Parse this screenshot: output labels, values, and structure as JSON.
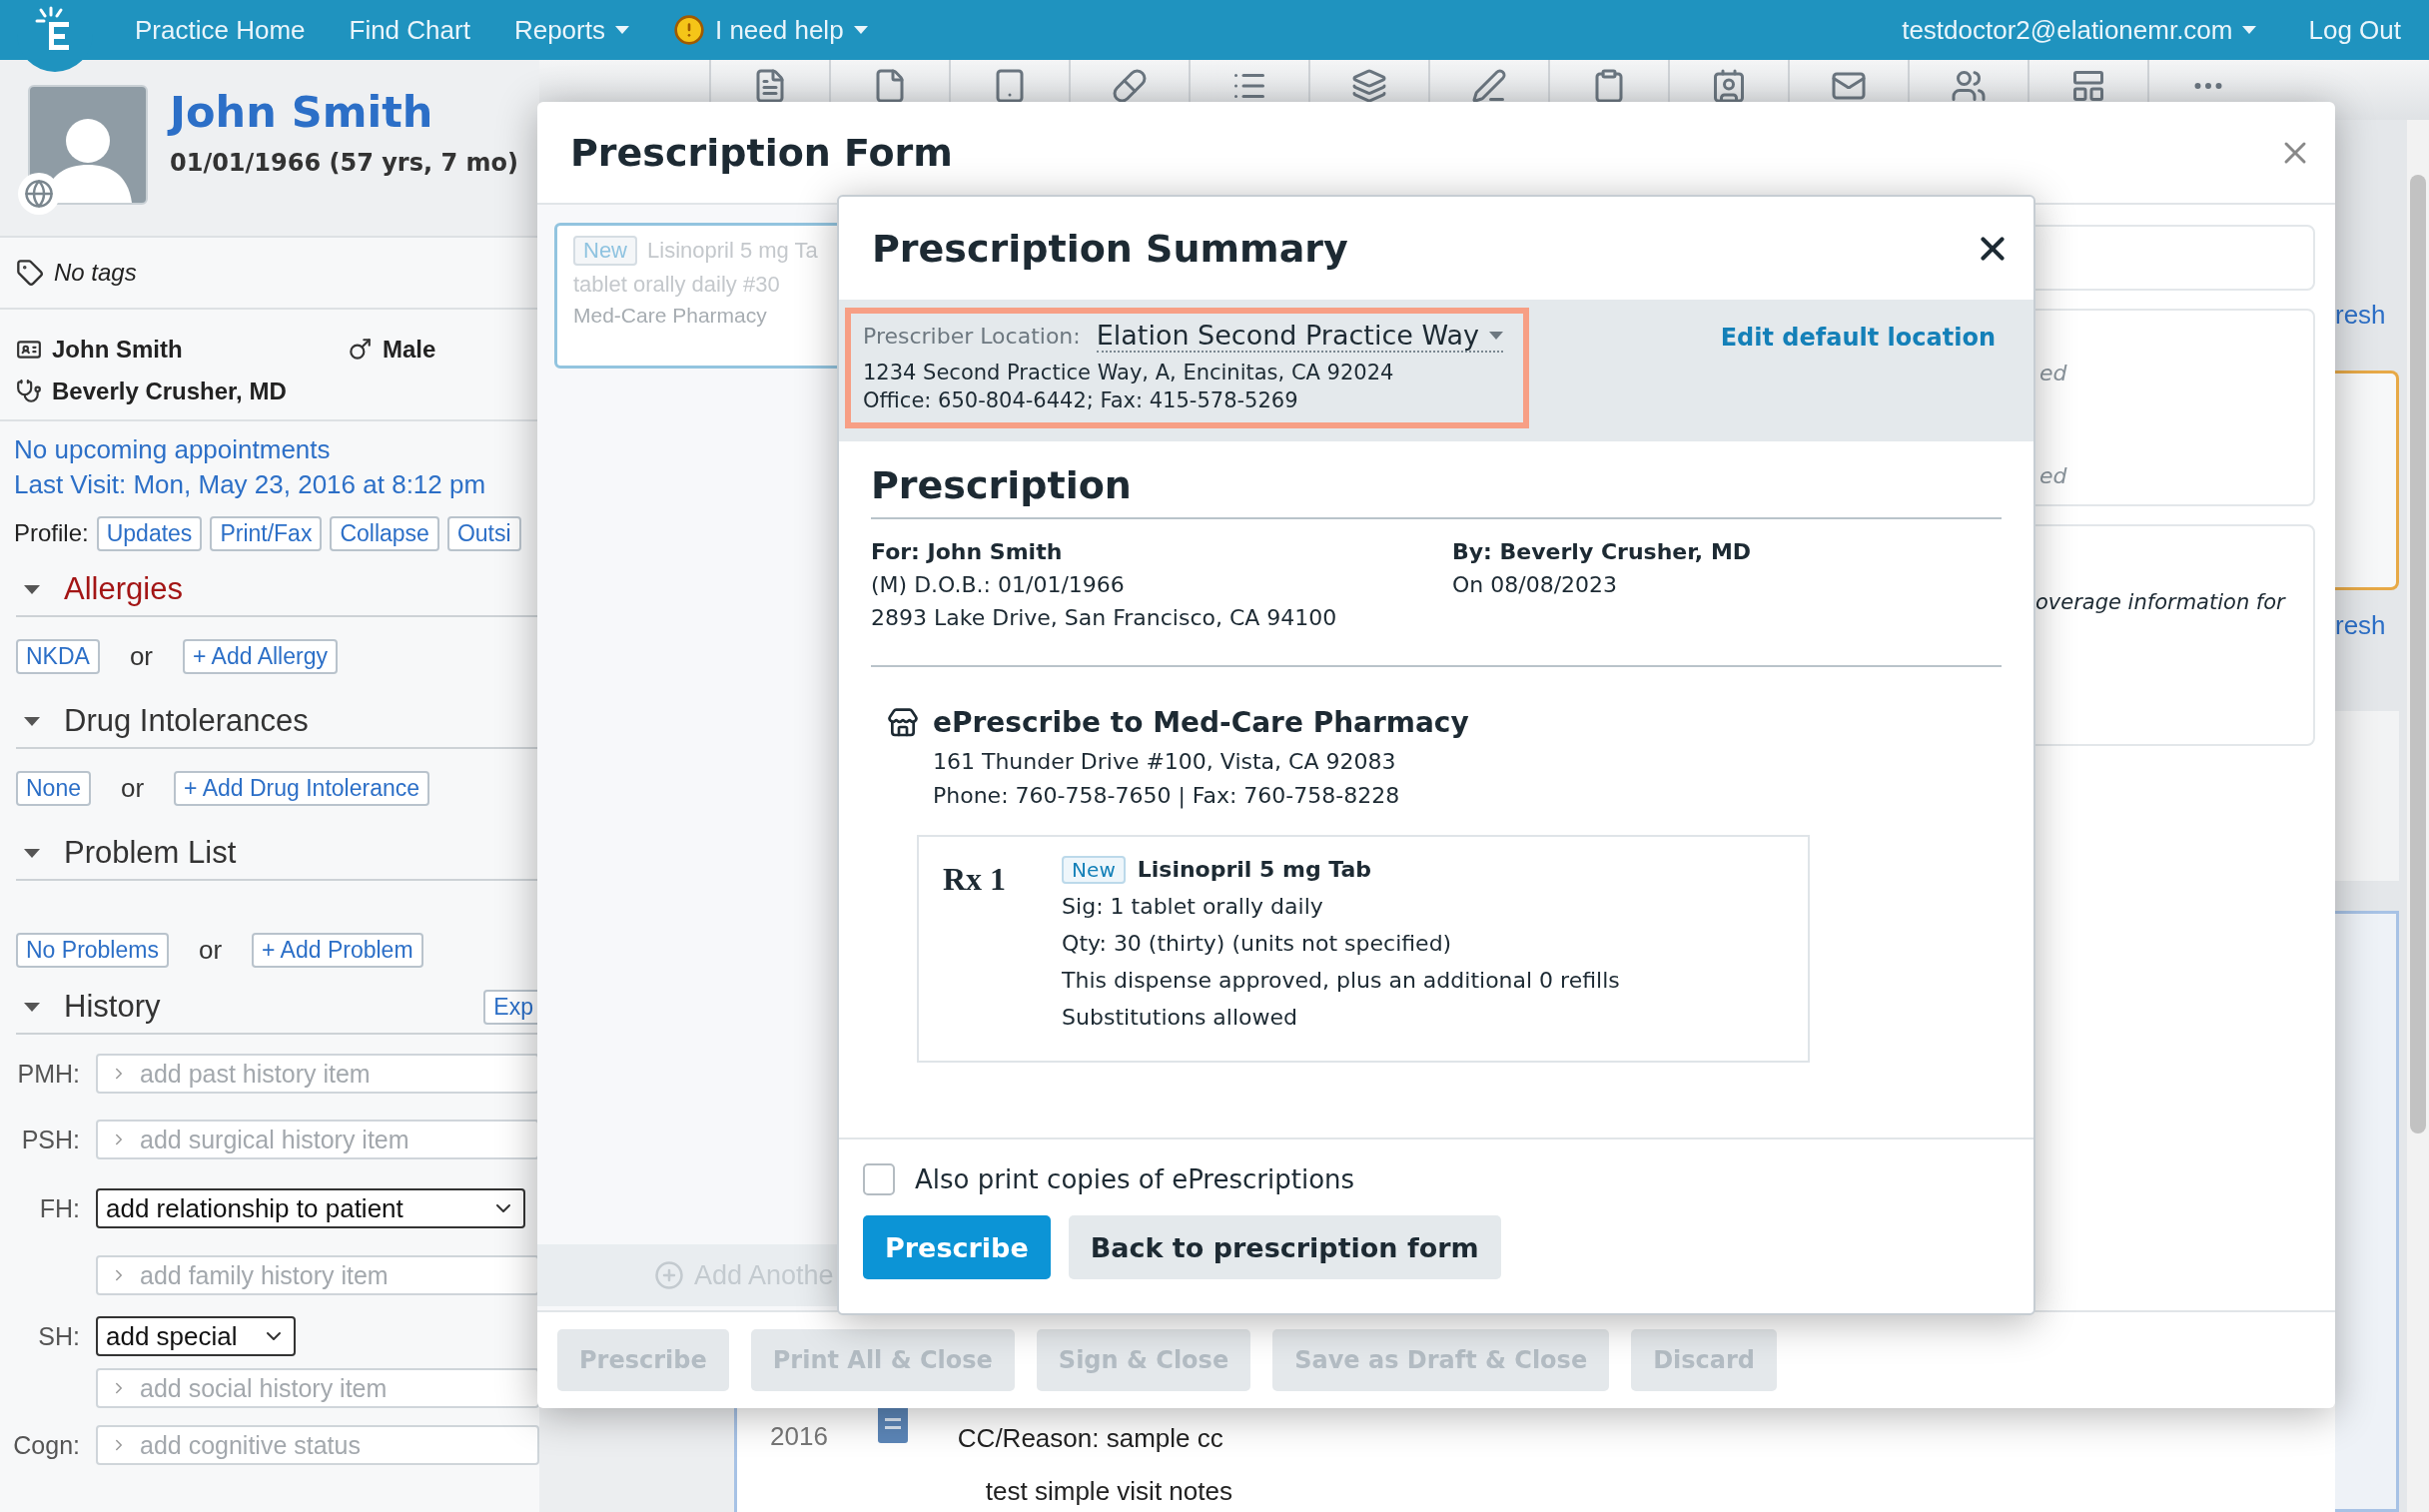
{
  "nav": {
    "items": [
      {
        "label": "Practice Home",
        "caret": false,
        "alert": false
      },
      {
        "label": "Find Chart",
        "caret": false,
        "alert": false
      },
      {
        "label": "Reports",
        "caret": true,
        "alert": false
      },
      {
        "label": "I need help",
        "caret": true,
        "alert": true
      }
    ],
    "account": {
      "label": "testdoctor2@elationemr.com",
      "caret": true
    },
    "logout": "Log Out"
  },
  "patient": {
    "name": "John Smith",
    "dob": "01/01/1966 (57 yrs, 7 mo)",
    "tags": "No tags",
    "display_name": "John Smith",
    "sex": "Male",
    "provider": "Beverly Crusher, MD",
    "appointments": "No upcoming appointments",
    "last_visit": "Last Visit: Mon, May 23, 2016 at 8:12 pm",
    "profile_label": "Profile:",
    "profile_buttons": [
      "Updates",
      "Print/Fax",
      "Collapse",
      "Outsi"
    ]
  },
  "sections": [
    {
      "title": "Allergies",
      "alert": true,
      "expanded": true,
      "actions": [
        "NKDA",
        "+ Add Allergy"
      ],
      "separator": "or"
    },
    {
      "title": "Drug Intolerances",
      "alert": false,
      "expanded": true,
      "actions": [
        "None",
        "+ Add Drug Intolerance"
      ],
      "separator": "or"
    },
    {
      "title": "Problem List",
      "alert": false,
      "expanded": true,
      "actions": [
        "No Problems",
        "+ Add Problem"
      ],
      "separator": "or"
    },
    {
      "title": "History",
      "alert": false,
      "expanded": true,
      "button": "Exp"
    }
  ],
  "history": [
    {
      "label": "PMH:",
      "kind": "input",
      "placeholder": "add past history item"
    },
    {
      "label": "PSH:",
      "kind": "input",
      "placeholder": "add surgical history item"
    },
    {
      "label": "FH:",
      "kind": "select",
      "value": "add relationship to patient"
    },
    {
      "kind": "input",
      "placeholder": "add family history item"
    },
    {
      "label": "SH:",
      "kind": "select",
      "value": "add special"
    },
    {
      "kind": "input",
      "placeholder": "add social history item"
    },
    {
      "label": "Cogn:",
      "kind": "input",
      "placeholder": "add cognitive status"
    }
  ],
  "background": {
    "refresh_links": [
      "resh",
      "resh"
    ],
    "timeline": {
      "year": "2016",
      "reason": "CC/Reason: sample cc",
      "note": "test simple visit notes"
    }
  },
  "form": {
    "title": "Prescription Form",
    "draft": {
      "badge": "New",
      "drug": "Lisinopril 5 mg Ta",
      "sig": "tablet orally daily #30",
      "pharmacy": "Med-Care Pharmacy"
    },
    "notes": [
      "ed",
      "ed"
    ],
    "coverage": "overage information for",
    "add_another": "Add Anothe",
    "buttons": [
      {
        "label": "Prescribe",
        "disabled": true
      },
      {
        "label": "Print All & Close",
        "disabled": true
      },
      {
        "label": "Sign & Close",
        "disabled": true
      },
      {
        "label": "Save as Draft & Close",
        "disabled": true
      },
      {
        "label": "Discard",
        "disabled": true
      }
    ]
  },
  "summary": {
    "title": "Prescription Summary",
    "location": {
      "label": "Prescriber Location:",
      "value": "Elation Second Practice Way",
      "address": "1234 Second Practice Way, A, Encinitas, CA 92024",
      "phones": "Office: 650-804-6442; Fax: 415-578-5269",
      "highlighted": true
    },
    "edit_link": "Edit default location",
    "heading": "Prescription",
    "patient": [
      "For: John Smith",
      "(M) D.O.B.: 01/01/1966",
      "2893 Lake Drive, San Francisco, CA 94100"
    ],
    "prescriber": [
      "By: Beverly Crusher, MD",
      "On 08/08/2023"
    ],
    "pharmacy": {
      "title": "ePrescribe to Med-Care Pharmacy",
      "address": "161 Thunder Drive #100, Vista, CA 92083",
      "phone": "Phone: 760-758-7650 | Fax: 760-758-8228"
    },
    "rx": {
      "label": "Rx 1",
      "badge": "New",
      "drug": "Lisinopril 5 mg Tab",
      "lines": [
        "Sig: 1 tablet orally daily",
        "Qty: 30 (thirty) (units not specified)",
        "This dispense approved, plus an additional 0 refills",
        "Substitutions allowed"
      ]
    },
    "print_copies": {
      "label": "Also print copies of ePrescriptions",
      "checked": false
    },
    "buttons": [
      {
        "label": "Prescribe",
        "kind": "primary"
      },
      {
        "label": "Back to prescription form",
        "kind": "secondary"
      }
    ]
  }
}
